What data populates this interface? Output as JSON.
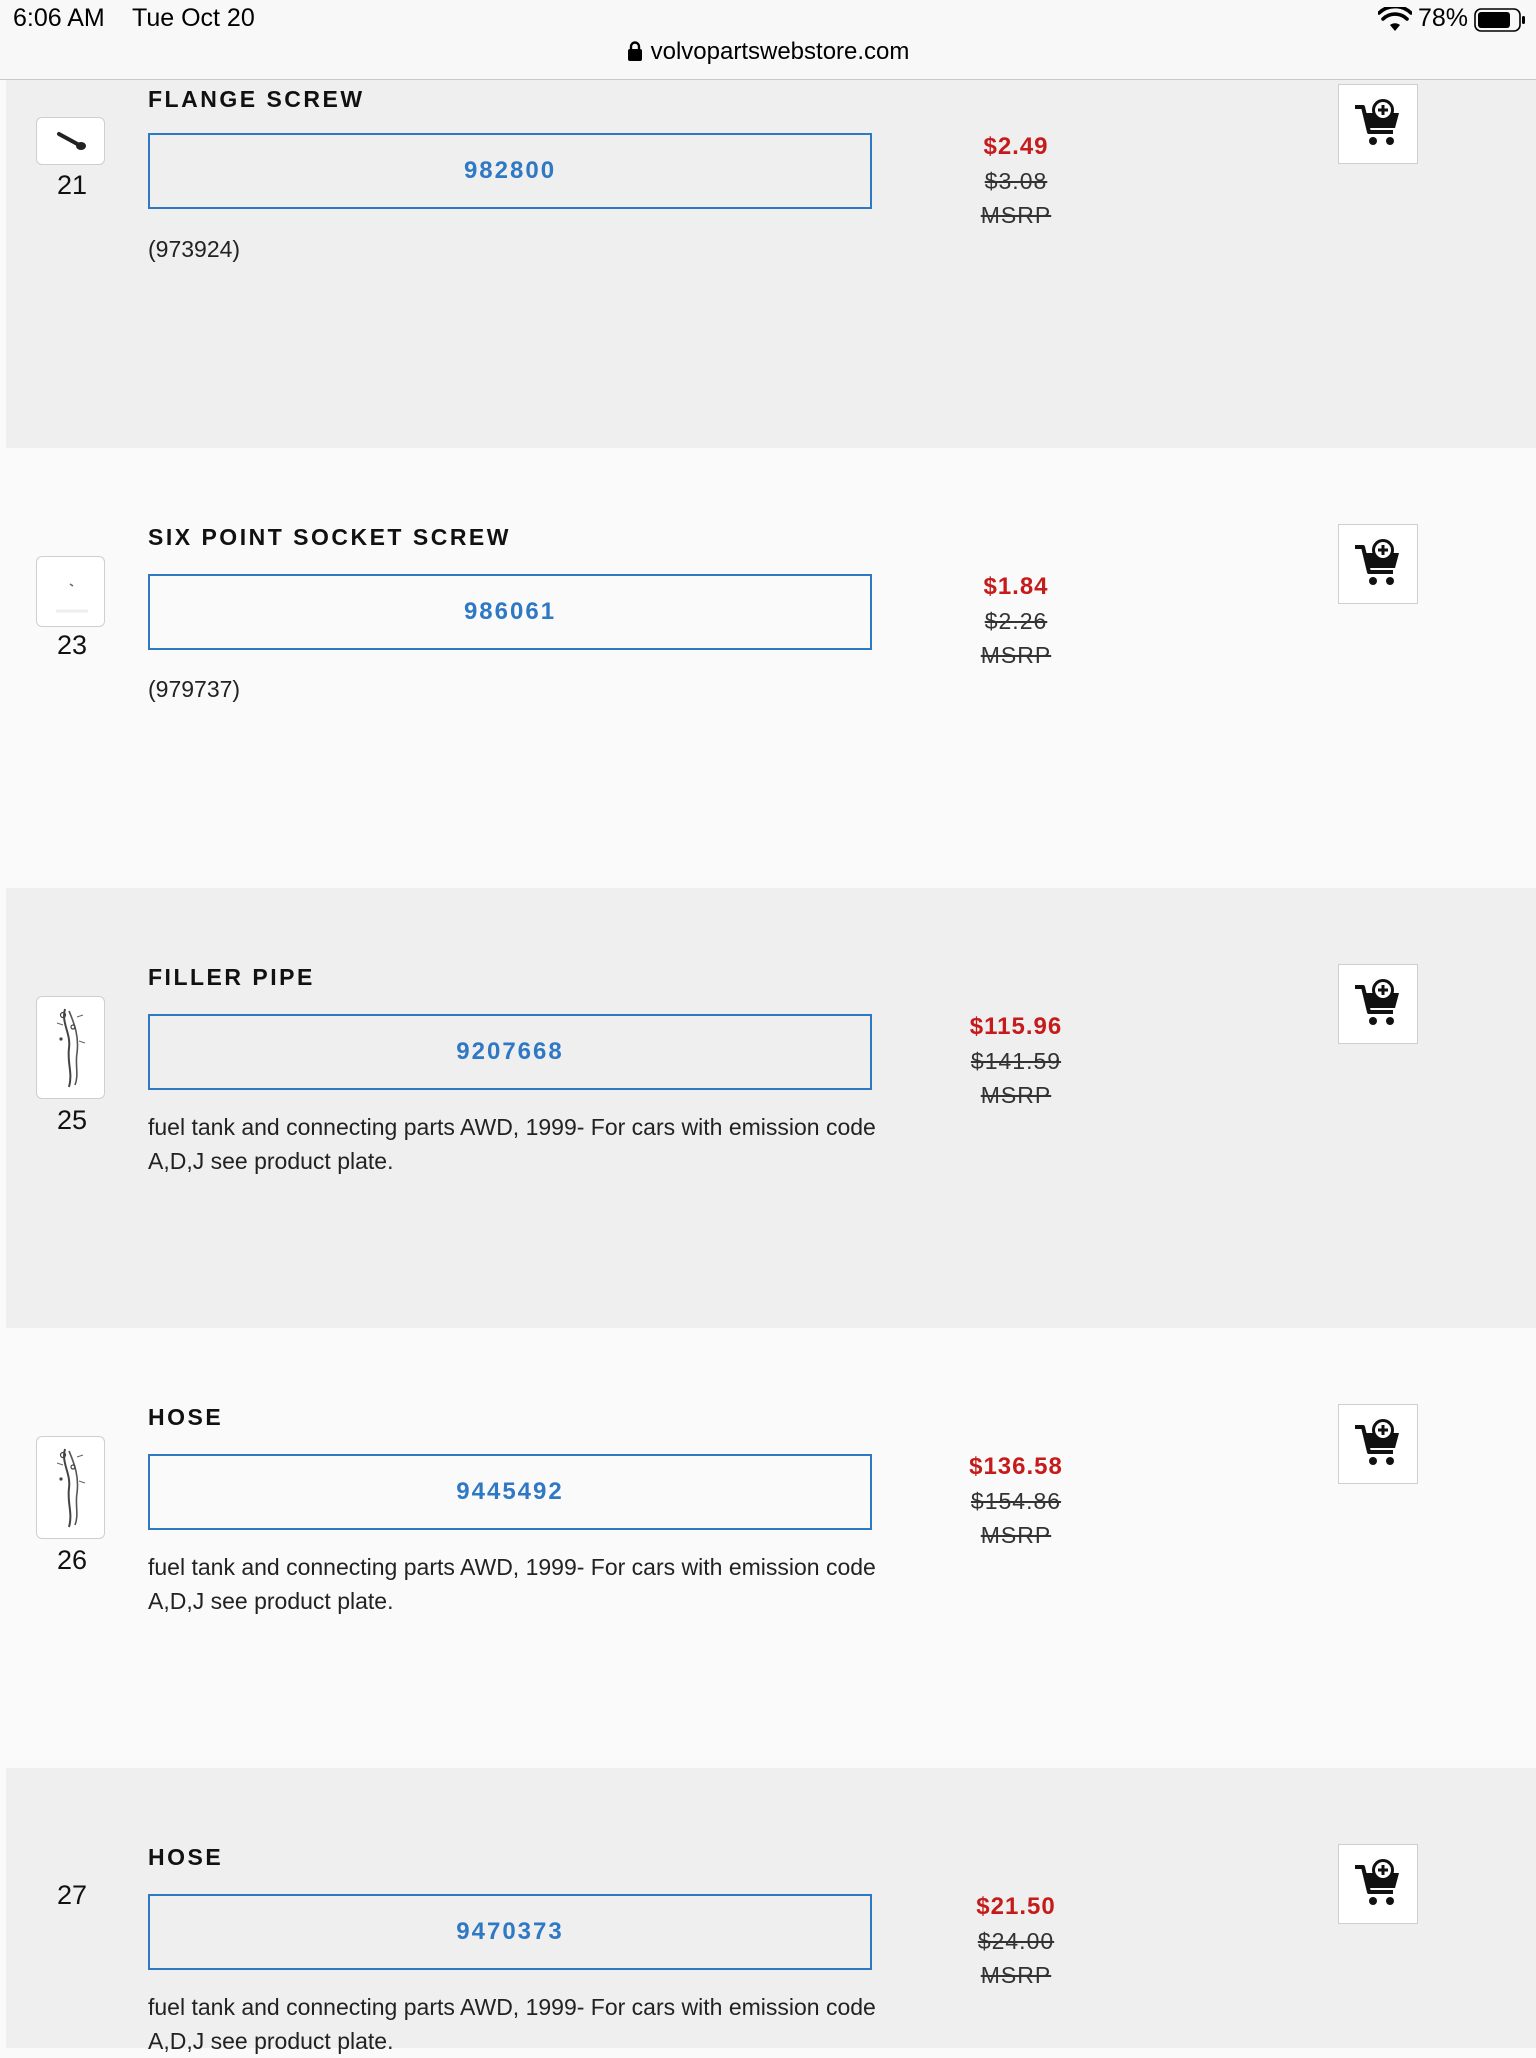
{
  "status_bar": {
    "time": "6:06 AM",
    "date": "Tue Oct 20",
    "battery": "78%",
    "url": "volvopartswebstore.com"
  },
  "colors": {
    "part_number": "#2f78c4",
    "sale_price": "#c51b1b",
    "row_gray": "#efefef",
    "row_white": "#fafafa"
  },
  "parts": [
    {
      "ref": "21",
      "title": "FLANGE SCREW",
      "part_number": "982800",
      "description": "(973924)",
      "price": "$2.49",
      "old_price": "$3.08",
      "msrp_label": "MSRP",
      "thumbnail": "flange-screw-icon"
    },
    {
      "ref": "23",
      "title": "SIX POINT SOCKET SCREW",
      "part_number": "986061",
      "description": "(979737)",
      "price": "$1.84",
      "old_price": "$2.26",
      "msrp_label": "MSRP",
      "thumbnail": "socket-screw-icon"
    },
    {
      "ref": "25",
      "title": "FILLER PIPE",
      "part_number": "9207668",
      "description": "fuel tank and connecting parts AWD, 1999- For cars with emission code A,D,J see product plate.",
      "price": "$115.96",
      "old_price": "$141.59",
      "msrp_label": "MSRP",
      "thumbnail": "filler-pipe-diagram-icon"
    },
    {
      "ref": "26",
      "title": "HOSE",
      "part_number": "9445492",
      "description": "fuel tank and connecting parts AWD, 1999- For cars with emission code A,D,J see product plate.",
      "price": "$136.58",
      "old_price": "$154.86",
      "msrp_label": "MSRP",
      "thumbnail": "hose-diagram-icon"
    },
    {
      "ref": "27",
      "title": "HOSE",
      "part_number": "9470373",
      "description": "fuel tank and connecting parts AWD, 1999- For cars with emission code A,D,J see product plate.",
      "price": "$21.50",
      "old_price": "$24.00",
      "msrp_label": "MSRP",
      "thumbnail": ""
    }
  ]
}
